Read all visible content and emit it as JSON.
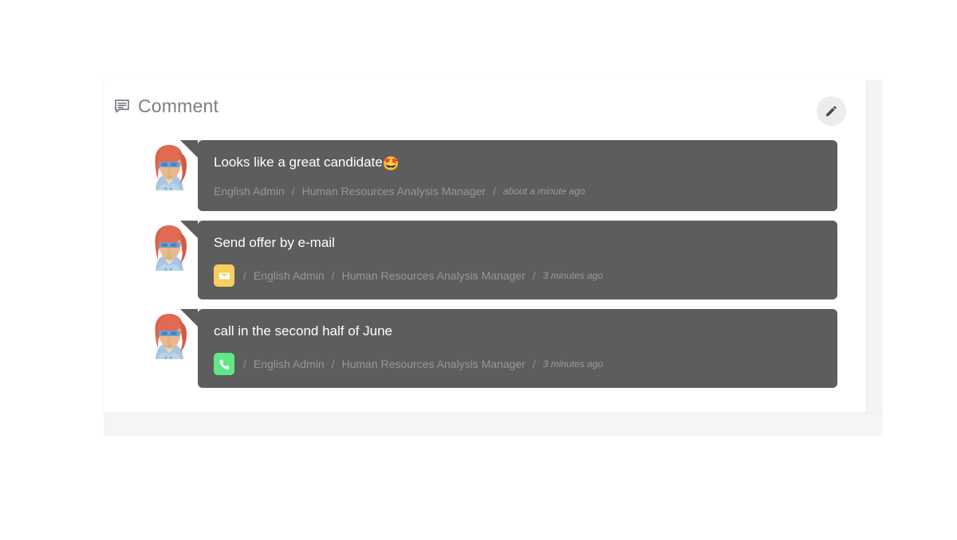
{
  "panel": {
    "title": "Comment",
    "title_icon": "comment-bubble-icon",
    "edit_button": {
      "icon": "pencil-icon",
      "label": "Edit"
    }
  },
  "colors": {
    "bubble_bg": "#5d5d5d",
    "bubble_text": "#ffffff",
    "meta_text": "#979797",
    "card_bg": "#ffffff",
    "page_bg": "#ffffff",
    "panel_bg": "#f5f5f5",
    "edit_button_bg": "#ececec",
    "badge_email": "#f7cf5d",
    "badge_phone": "#61e787"
  },
  "comments": [
    {
      "avatar": "avatar-illustration",
      "text": "Looks like a great candidate",
      "emoji": "🤩",
      "channel": null,
      "channel_icon": null,
      "user": "English Admin",
      "role": "Human Resources Analysis Manager",
      "time": "about a minute ago",
      "separator": "/"
    },
    {
      "avatar": "avatar-illustration",
      "text": "Send offer by e-mail",
      "emoji": "",
      "channel": "email",
      "channel_icon": "envelope-icon",
      "user": "English Admin",
      "role": "Human Resources Analysis Manager",
      "time": "3 minutes ago",
      "separator": "/"
    },
    {
      "avatar": "avatar-illustration",
      "text": "call in the second half of June",
      "emoji": "",
      "channel": "phone",
      "channel_icon": "phone-icon",
      "user": "English Admin",
      "role": "Human Resources Analysis Manager",
      "time": "3 minutes ago",
      "separator": "/"
    }
  ]
}
